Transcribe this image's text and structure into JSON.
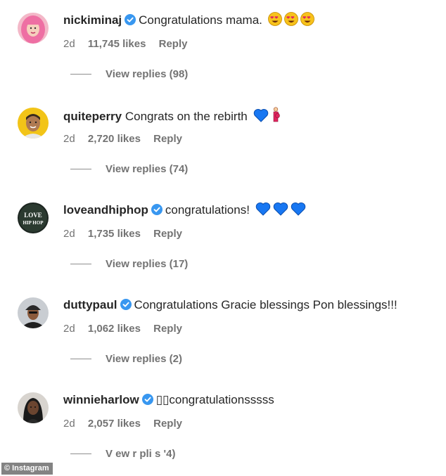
{
  "colors": {
    "verified_badge": "#3897f0",
    "heart_blue": "#1877f2",
    "meta_gray": "#737373",
    "text": "#262626"
  },
  "comments": [
    {
      "username": "nickiminaj",
      "verified": true,
      "text": "Congratulations mama.",
      "emoji": [
        "heart-eyes-face",
        "heart-eyes-face",
        "heart-eyes-face"
      ],
      "age": "2d",
      "likes": "11,745 likes",
      "reply_label": "Reply",
      "view_replies": "View replies (98)"
    },
    {
      "username": "quiteperry",
      "verified": false,
      "text": "Congrats on the rebirth",
      "emoji": [
        "blue-heart",
        "pregnant-woman"
      ],
      "age": "2d",
      "likes": "2,720 likes",
      "reply_label": "Reply",
      "view_replies": "View replies (74)"
    },
    {
      "username": "loveandhiphop",
      "verified": true,
      "text": "congratulations!",
      "emoji": [
        "blue-heart",
        "blue-heart",
        "blue-heart"
      ],
      "age": "2d",
      "likes": "1,735 likes",
      "reply_label": "Reply",
      "view_replies": "View replies (17)"
    },
    {
      "username": "duttypaul",
      "verified": true,
      "text": "Congratulations Gracie blessings Pon blessings!!!",
      "emoji": [],
      "age": "2d",
      "likes": "1,062 likes",
      "reply_label": "Reply",
      "view_replies": "View replies (2)"
    },
    {
      "username": "winnieharlow",
      "verified": true,
      "text": "▯▯congratulationsssss",
      "emoji": [],
      "age": "2d",
      "likes": "2,057 likes",
      "reply_label": "Reply",
      "view_replies": "V  ew  r  pli s  '4)"
    }
  ],
  "avatars": [
    "pink-haired-woman-avatar",
    "man-yellow-background-avatar",
    "love-and-hiphop-logo-avatar",
    "man-cap-avatar",
    "woman-avatar"
  ],
  "avatar_logo_text": {
    "line1": "LOVE",
    "line2": "HIP HOP"
  },
  "watermark": {
    "symbol": "©",
    "text": "Instagram"
  }
}
